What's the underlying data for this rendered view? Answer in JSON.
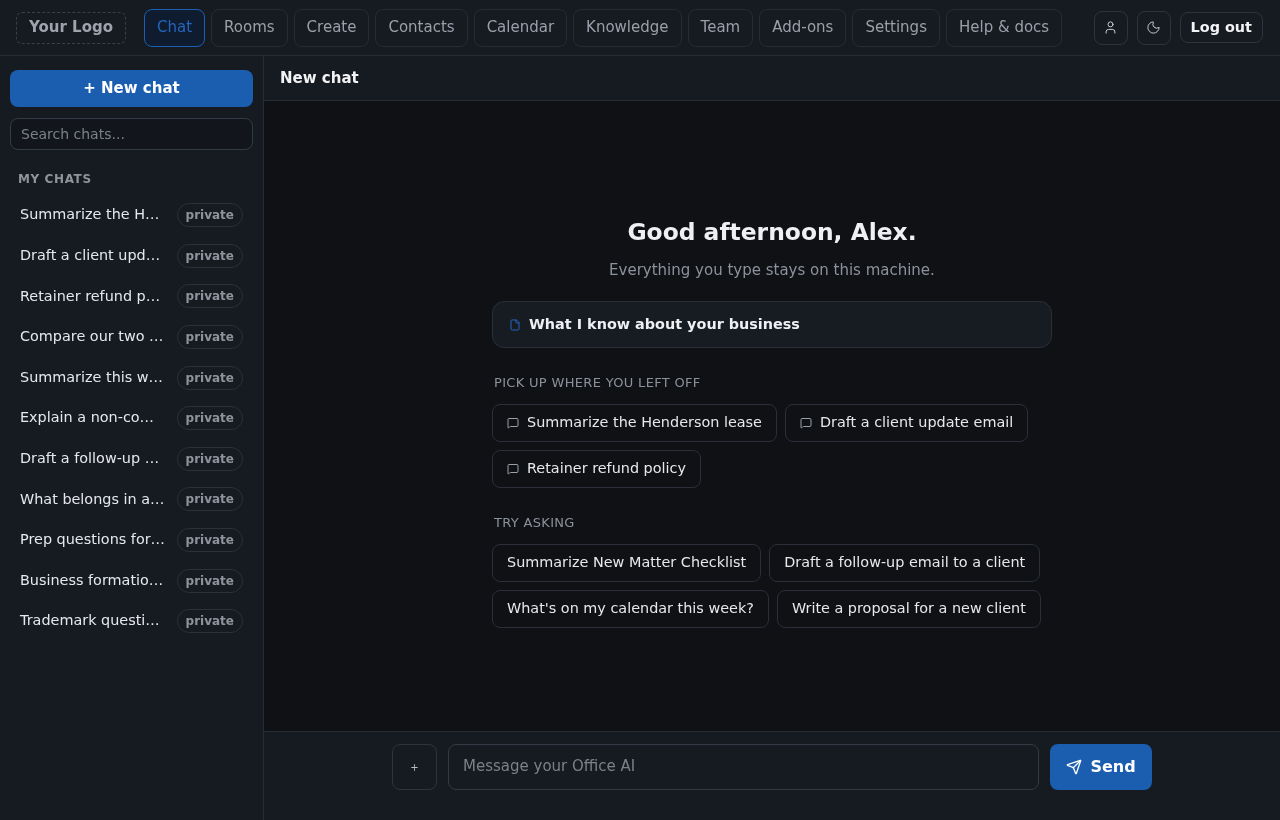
{
  "header": {
    "logo": "Your Logo",
    "nav": [
      {
        "label": "Chat",
        "selected": true
      },
      {
        "label": "Rooms",
        "selected": false
      },
      {
        "label": "Create",
        "selected": false
      },
      {
        "label": "Contacts",
        "selected": false
      },
      {
        "label": "Calendar",
        "selected": false
      },
      {
        "label": "Knowledge",
        "selected": false
      },
      {
        "label": "Team",
        "selected": false
      },
      {
        "label": "Add-ons",
        "selected": false
      },
      {
        "label": "Settings",
        "selected": false
      },
      {
        "label": "Help & docs",
        "selected": false
      }
    ],
    "logout": "Log out"
  },
  "sidebar": {
    "new_chat": "+ New chat",
    "search": {
      "placeholder": "Search chats..."
    },
    "section_title": "MY CHATS",
    "chats": [
      {
        "title": "Summarize the H…",
        "badge": "private"
      },
      {
        "title": "Draft a client upd…",
        "badge": "private"
      },
      {
        "title": "Retainer refund p…",
        "badge": "private"
      },
      {
        "title": "Compare our two …",
        "badge": "private"
      },
      {
        "title": "Summarize this w…",
        "badge": "private"
      },
      {
        "title": "Explain a non-co…",
        "badge": "private"
      },
      {
        "title": "Draft a follow-up …",
        "badge": "private"
      },
      {
        "title": "What belongs in a…",
        "badge": "private"
      },
      {
        "title": "Prep questions for…",
        "badge": "private"
      },
      {
        "title": "Business formatio…",
        "badge": "private"
      },
      {
        "title": "Trademark questi…",
        "badge": "private"
      }
    ]
  },
  "main": {
    "title": "New chat",
    "greeting": "Good afternoon, Alex.",
    "subtitle": "Everything you type stays on this machine.",
    "knowledge_card": "What I know about your business",
    "recent": {
      "heading": "PICK UP WHERE YOU LEFT OFF",
      "items": [
        "Summarize the Henderson lease",
        "Draft a client update email",
        "Retainer refund policy"
      ]
    },
    "suggestions": {
      "heading": "TRY ASKING",
      "items": [
        "Summarize New Matter Checklist",
        "Draft a follow-up email to a client",
        "What's on my calendar this week?",
        "Write a proposal for a new client"
      ]
    }
  },
  "composer": {
    "attach": "+",
    "placeholder": "Message your Office AI",
    "send": "Send"
  }
}
